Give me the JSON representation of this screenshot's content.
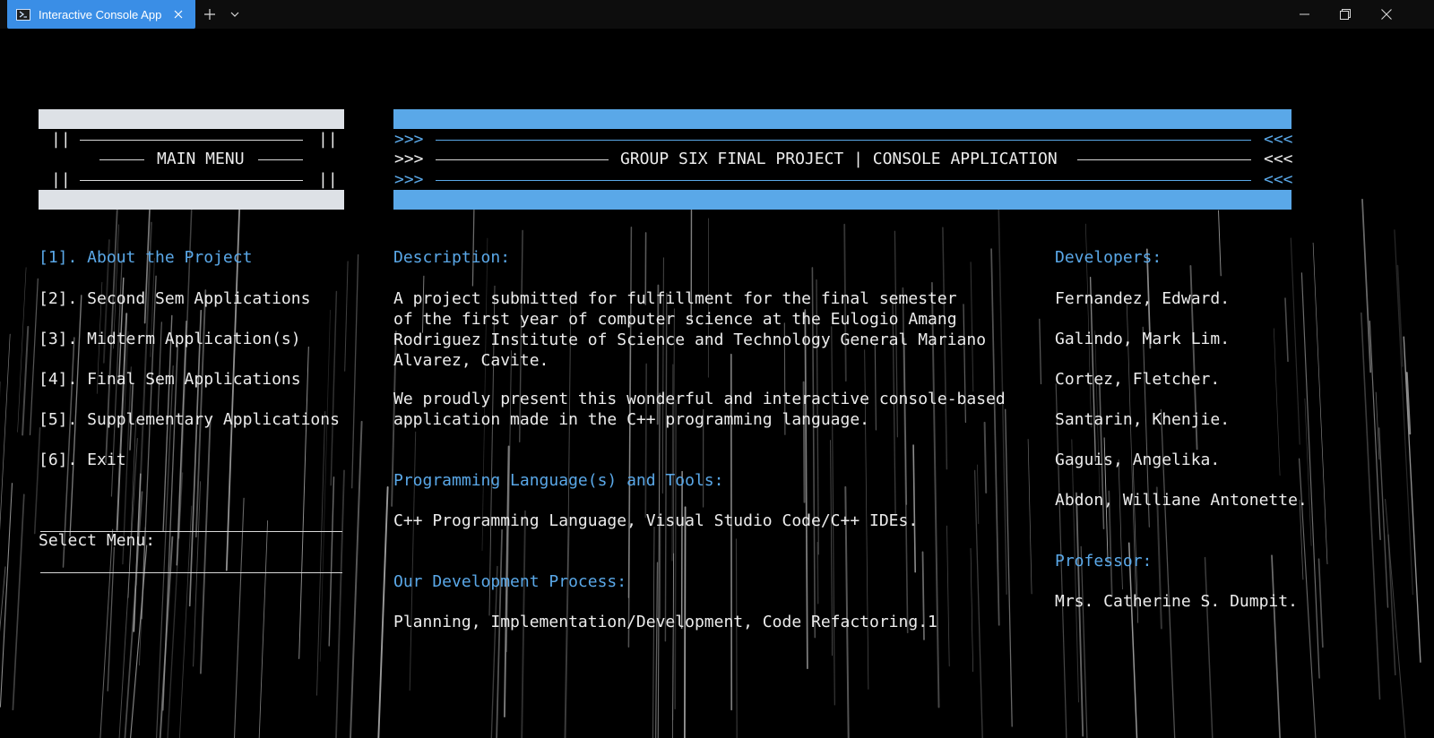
{
  "window": {
    "tab_title": "Interactive Console App",
    "icons": {
      "app": "powershell-icon",
      "close_tab": "close-icon",
      "new_tab": "plus-icon",
      "dropdown": "chevron-down-icon",
      "minimize": "minimize-icon",
      "maximize": "maximize-icon",
      "close": "close-icon"
    }
  },
  "colors": {
    "accent": "#5aa8e8",
    "tab": "#3a8ee6",
    "background": "#000000",
    "text": "#ececec",
    "menu_bar": "#dde1e6"
  },
  "menu": {
    "header_left_bars": "||",
    "header_right_bars": "||",
    "title": "MAIN MENU",
    "items": [
      {
        "label": "[1]. About the Project"
      },
      {
        "label": "[2]. Second Sem Applications"
      },
      {
        "label": "[3]. Midterm Application(s)"
      },
      {
        "label": "[4]. Final Sem Applications"
      },
      {
        "label": "[5]. Supplementary Applications"
      },
      {
        "label": "[6]. Exit"
      }
    ],
    "prompt": "Select Menu:"
  },
  "banner": {
    "left_marker": ">>>",
    "right_marker": "<<<",
    "title": "GROUP SIX FINAL PROJECT | CONSOLE APPLICATION"
  },
  "about": {
    "description_heading": "Description:",
    "description_p1": "A project submitted for fulfillment for the final semester\nof the first year of computer science at the Eulogio Amang\nRodriguez Institute of Science and Technology General Mariano\nAlvarez, Cavite.",
    "description_p2": "We proudly present this wonderful and interactive console-based\napplication made in the C++ programming language.",
    "tools_heading": "Programming Language(s) and Tools:",
    "tools_text": "C++ Programming Language, Visual Studio Code/C++ IDEs.",
    "process_heading": "Our Development Process:",
    "process_text": "Planning, Implementation/Development, Code Refactoring.1"
  },
  "credits": {
    "developers_heading": "Developers:",
    "developers": [
      "Fernandez, Edward.",
      "Galindo, Mark Lim.",
      "Cortez, Fletcher.",
      "Santarin, Khenjie.",
      "Gaguis, Angelika.",
      "Abdon, Williane Antonette."
    ],
    "professor_heading": "Professor:",
    "professor": "Mrs. Catherine S. Dumpit."
  }
}
